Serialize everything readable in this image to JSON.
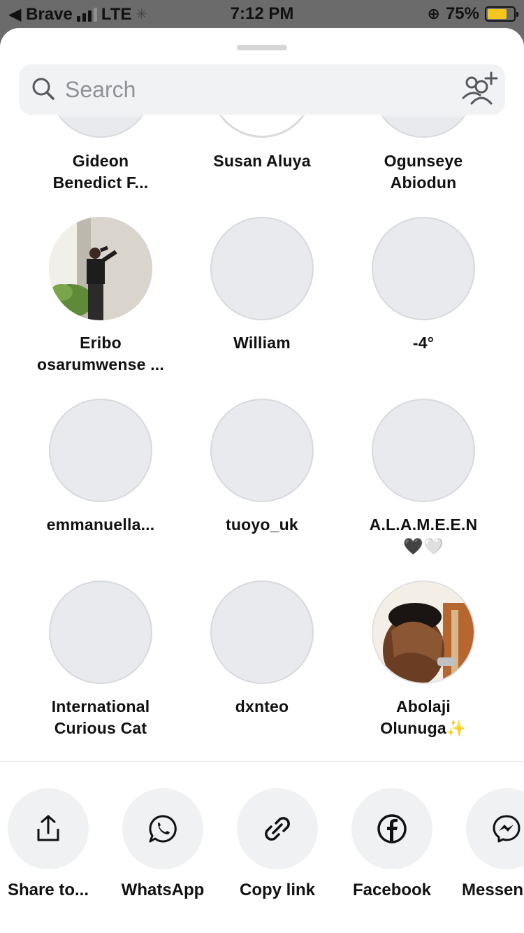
{
  "status_bar": {
    "carrier_back": "◀ Brave",
    "network": "LTE",
    "time": "7:12 PM",
    "battery_percent": "75%"
  },
  "search": {
    "placeholder": "Search"
  },
  "people": [
    {
      "line1": "Gideon",
      "line2": "Benedict F..."
    },
    {
      "line1": "Susan Aluya",
      "line2": ""
    },
    {
      "line1": "Ogunseye",
      "line2": "Abiodun"
    },
    {
      "line1": "Eribo",
      "line2": "osarumwense ..."
    },
    {
      "line1": "William",
      "line2": ""
    },
    {
      "line1": "-4°",
      "line2": ""
    },
    {
      "line1": "emmanuella...",
      "line2": ""
    },
    {
      "line1": "tuoyo_uk",
      "line2": ""
    },
    {
      "line1": "A.L.A.M.E.E.N",
      "line2": "🖤🤍"
    },
    {
      "line1": "International",
      "line2": "Curious Cat"
    },
    {
      "line1": "dxnteo",
      "line2": ""
    },
    {
      "line1": "Abolaji",
      "line2": "Olunuga✨"
    }
  ],
  "share": {
    "share_to": "Share to...",
    "whatsapp": "WhatsApp",
    "copy_link": "Copy link",
    "facebook": "Facebook",
    "messenger": "Messenger"
  },
  "colors": {
    "sheet_bg": "#ffffff",
    "avatar_placeholder": "#e8eaed",
    "status_bg": "#6b6b6b"
  }
}
